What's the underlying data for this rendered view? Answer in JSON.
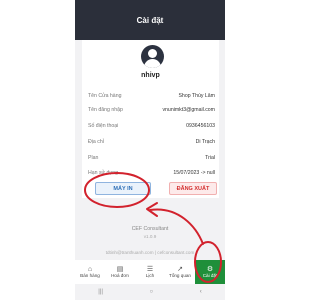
{
  "header": {
    "title": "Cài đặt"
  },
  "profile": {
    "username": "nhivp"
  },
  "info": [
    {
      "label": "Tên Cửa hàng",
      "value": "Shop Thúy Lâm"
    },
    {
      "label": "Tên đăng nhập",
      "value": "vnunimkt3@gmail.com"
    },
    {
      "label": "Số điện thoại",
      "value": "0936456103"
    },
    {
      "label": "Địa chỉ",
      "value": "Di Trạch"
    },
    {
      "label": "Plan",
      "value": "Trial"
    },
    {
      "label": "Hạn sử dụng",
      "value": "15/07/2023 -> null"
    }
  ],
  "buttons": {
    "print": "MÁY IN",
    "logout": "ĐĂNG XUẤT"
  },
  "footer": {
    "brand": "CEF Consultant",
    "version": "v1.0.9",
    "contact": "tdtinh@tranthuanh.com | cefconsultant.com"
  },
  "nav": {
    "items": [
      {
        "label": "Bán hàng",
        "icon": "store-icon",
        "glyph": "⌂"
      },
      {
        "label": "Hoá đơn",
        "icon": "receipt-icon",
        "glyph": "▤"
      },
      {
        "label": "Lịch",
        "icon": "calendar-icon",
        "glyph": "☰"
      },
      {
        "label": "Tổng quan",
        "icon": "chart-icon",
        "glyph": "↗"
      },
      {
        "label": "Cài đặt",
        "icon": "settings-icon",
        "glyph": "⚙"
      }
    ]
  },
  "colors": {
    "header_bg": "#2b2f3a",
    "accent_green": "#1f8f3a",
    "annotation_red": "#d2222d",
    "print_blue": "#2d6fb7",
    "logout_red": "#d32f2f"
  }
}
